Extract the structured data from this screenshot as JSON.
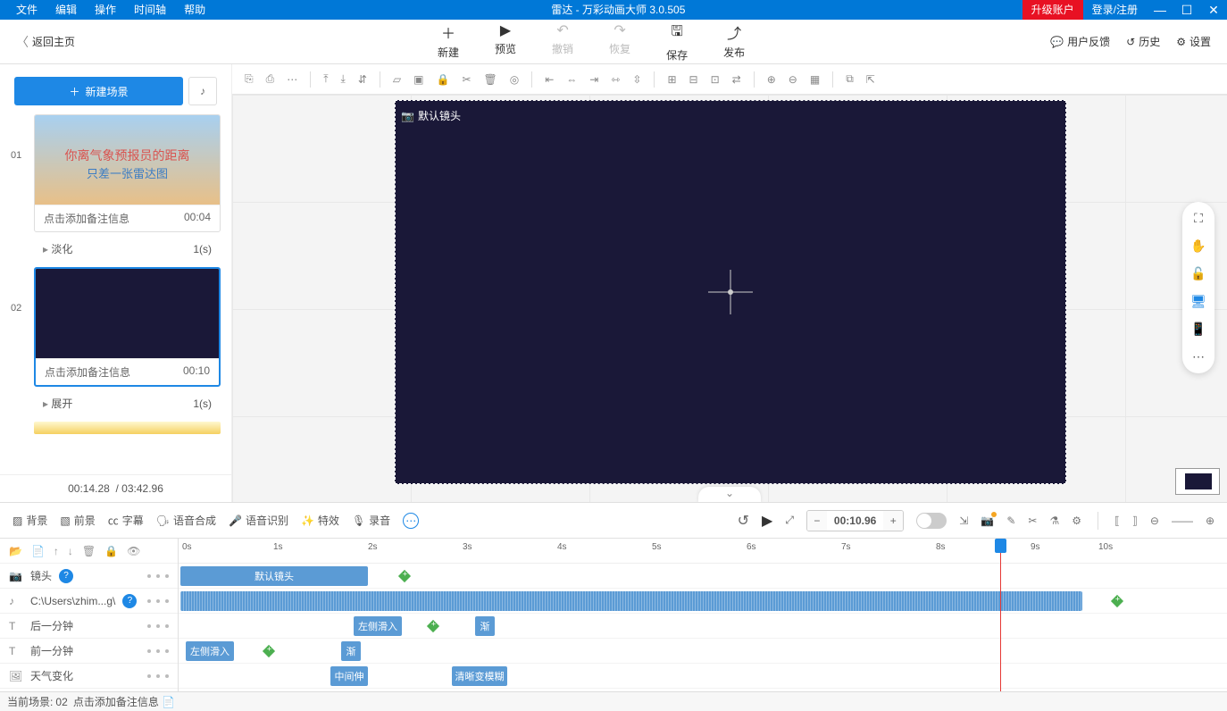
{
  "title": "雷达 - 万彩动画大师 3.0.505",
  "menu": [
    "文件",
    "编辑",
    "操作",
    "时间轴",
    "帮助"
  ],
  "upgrade": "升级账户",
  "login": "登录/注册",
  "back": "返回主页",
  "topActions": {
    "new": "新建",
    "preview": "预览",
    "undo": "撤销",
    "redo": "恢复",
    "save": "保存",
    "publish": "发布"
  },
  "topRight": {
    "feedback": "用户反馈",
    "history": "历史",
    "settings": "设置"
  },
  "newScene": "新建场景",
  "scenes": [
    {
      "num": "01",
      "line1": "你离气象预报员的距离",
      "line2": "只差一张雷达图",
      "note": "点击添加备注信息",
      "dur": "00:04",
      "trans": "淡化",
      "transDur": "1(s)"
    },
    {
      "num": "02",
      "note": "点击添加备注信息",
      "dur": "00:10",
      "trans": "展开",
      "transDur": "1(s)"
    }
  ],
  "footerTime": {
    "cur": "00:14.28",
    "total": "/ 03:42.96"
  },
  "camLabel": "默认镜头",
  "tlTabs": {
    "bg": "背景",
    "fg": "前景",
    "sub": "字幕",
    "tts": "语音合成",
    "asr": "语音识别",
    "fx": "特效",
    "rec": "录音"
  },
  "timecode": "00:10.96",
  "ruler": [
    "0s",
    "1s",
    "2s",
    "3s",
    "4s",
    "5s",
    "6s",
    "7s",
    "8s",
    "9s",
    "10s"
  ],
  "tracks": {
    "cam": "镜头",
    "audio": "C:\\Users\\zhim...g\\",
    "t1": "后一分钟",
    "t2": "前一分钟",
    "img": "天气变化"
  },
  "clips": {
    "defaultCam": "默认镜头",
    "slideL": "左侧滑入",
    "fade": "渐",
    "midStretch": "中间伸",
    "blur": "清晰变模糊"
  },
  "status": {
    "prefix": "当前场景:",
    "num": "02",
    "text": "点击添加备注信息"
  }
}
